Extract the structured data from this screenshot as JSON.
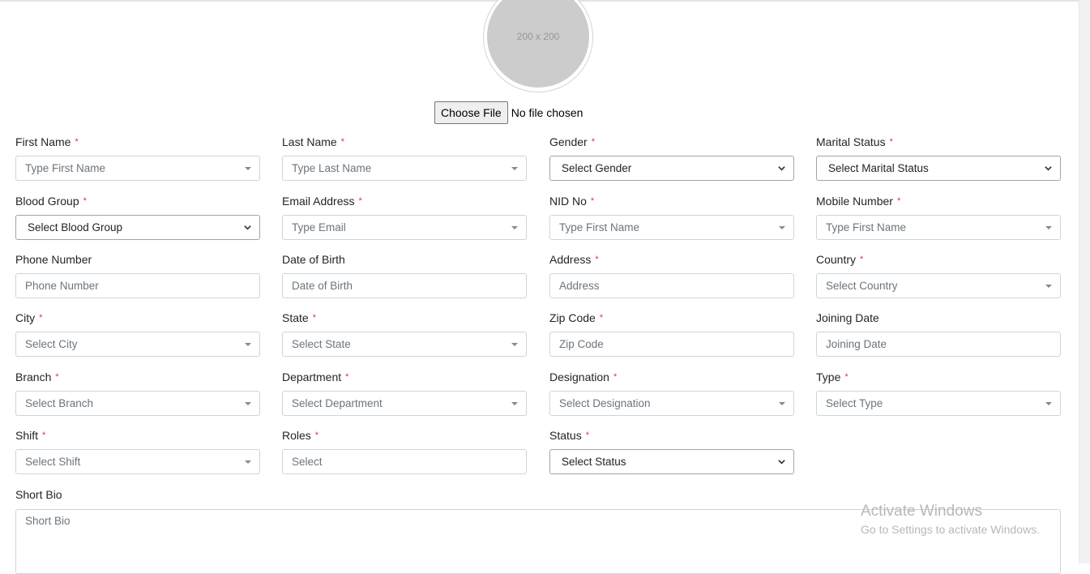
{
  "avatar": {
    "placeholder": "200 x 200"
  },
  "file_input": {
    "button_label": "Choose File",
    "status": "No file chosen"
  },
  "fields": {
    "first_name": {
      "label": "First Name",
      "required": "*",
      "placeholder": "Type First Name",
      "kind": "dropdown"
    },
    "last_name": {
      "label": "Last Name",
      "required": "*",
      "placeholder": "Type Last Name",
      "kind": "dropdown"
    },
    "gender": {
      "label": "Gender",
      "required": "*",
      "value": "Select Gender",
      "kind": "select"
    },
    "marital_status": {
      "label": "Marital Status",
      "required": "*",
      "value": "Select Marital Status",
      "kind": "select"
    },
    "blood_group": {
      "label": "Blood Group",
      "required": "*",
      "value": "Select Blood Group",
      "kind": "select"
    },
    "email": {
      "label": "Email Address",
      "required": "*",
      "placeholder": "Type Email",
      "kind": "dropdown"
    },
    "nid": {
      "label": "NID No",
      "required": "*",
      "placeholder": "Type First Name",
      "kind": "dropdown"
    },
    "mobile": {
      "label": "Mobile Number",
      "required": "*",
      "placeholder": "Type First Name",
      "kind": "dropdown"
    },
    "phone": {
      "label": "Phone Number",
      "placeholder": "Phone Number",
      "kind": "input"
    },
    "dob": {
      "label": "Date of Birth",
      "placeholder": "Date of Birth",
      "kind": "input"
    },
    "address": {
      "label": "Address",
      "required": "*",
      "placeholder": "Address",
      "kind": "input"
    },
    "country": {
      "label": "Country",
      "required": "*",
      "placeholder": "Select Country",
      "kind": "dropdown"
    },
    "city": {
      "label": "City",
      "required": "*",
      "placeholder": "Select City",
      "kind": "dropdown"
    },
    "state": {
      "label": "State",
      "required": "*",
      "placeholder": "Select State",
      "kind": "dropdown"
    },
    "zip": {
      "label": "Zip Code",
      "required": "*",
      "placeholder": "Zip Code",
      "kind": "input"
    },
    "joining_date": {
      "label": "Joining Date",
      "placeholder": "Joining Date",
      "kind": "input"
    },
    "branch": {
      "label": "Branch",
      "required": "*",
      "placeholder": "Select Branch",
      "kind": "dropdown"
    },
    "department": {
      "label": "Department",
      "required": "*",
      "placeholder": "Select Department",
      "kind": "dropdown"
    },
    "designation": {
      "label": "Designation",
      "required": "*",
      "placeholder": "Select Designation",
      "kind": "dropdown"
    },
    "type": {
      "label": "Type",
      "required": "*",
      "placeholder": "Select Type",
      "kind": "dropdown"
    },
    "shift": {
      "label": "Shift",
      "required": "*",
      "placeholder": "Select Shift",
      "kind": "dropdown"
    },
    "roles": {
      "label": "Roles",
      "required": "*",
      "placeholder": "Select",
      "kind": "input"
    },
    "status": {
      "label": "Status",
      "required": "*",
      "value": "Select Status",
      "kind": "select"
    }
  },
  "short_bio": {
    "label": "Short Bio",
    "placeholder": "Short Bio"
  },
  "watermark": {
    "title": "Activate Windows",
    "subtitle": "Go to Settings to activate Windows."
  }
}
